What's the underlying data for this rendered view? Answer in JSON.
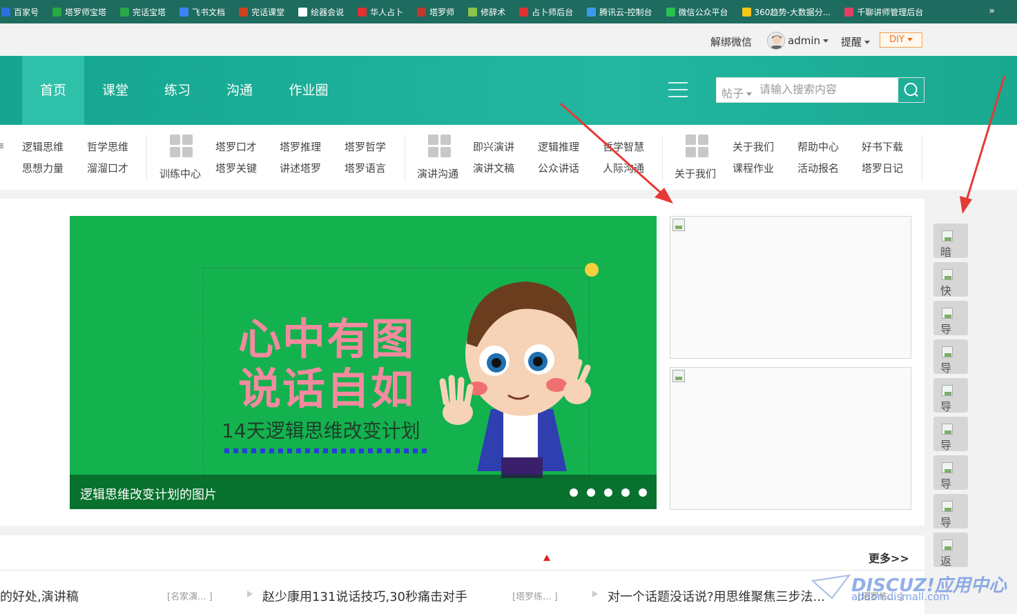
{
  "bookmarks": [
    {
      "label": "百家号",
      "color": "#2d6fe0",
      "icon": "baijiahao-icon"
    },
    {
      "label": "塔罗师宝塔",
      "color": "#27a844",
      "icon": "leaf-icon"
    },
    {
      "label": "完话宝塔",
      "color": "#27a844",
      "icon": "leaf-icon"
    },
    {
      "label": "飞书文档",
      "color": "#3b82f6",
      "icon": "doc-icon"
    },
    {
      "label": "完话课堂",
      "color": "#d04020",
      "icon": "sun-icon"
    },
    {
      "label": "绘器会说",
      "color": "#ffffff",
      "icon": "wordpress-icon"
    },
    {
      "label": "华人占卜",
      "color": "#e03030",
      "icon": "globe-icon"
    },
    {
      "label": "塔罗师",
      "color": "#c0392b",
      "icon": "pen-icon"
    },
    {
      "label": "修辞术",
      "color": "#8bc34a",
      "icon": "leaf-icon"
    },
    {
      "label": "占卜师后台",
      "color": "#e03030",
      "icon": "globe-icon"
    },
    {
      "label": "腾讯云-控制台",
      "color": "#3b9af0",
      "icon": "cloud-icon"
    },
    {
      "label": "微信公众平台",
      "color": "#27c24c",
      "icon": "wechat-icon"
    },
    {
      "label": "360趋势-大数据分...",
      "color": "#f5c518",
      "icon": "search-360-icon"
    },
    {
      "label": "千聊讲师管理后台",
      "color": "#e04060",
      "icon": "chat-icon"
    }
  ],
  "bookmarks_more": "»",
  "topbar": {
    "unbind_wechat": "解绑微信",
    "username": "admin",
    "remind": "提醒",
    "diy": "DIY"
  },
  "nav": {
    "items": [
      "首页",
      "课堂",
      "练习",
      "沟通",
      "作业圈"
    ],
    "active": 0
  },
  "search": {
    "type": "帖子",
    "placeholder": "请输入搜索内容"
  },
  "submenu": {
    "group1": {
      "row1": [
        "逻辑思维",
        "哲学思维"
      ],
      "row2": [
        "思想力量",
        "溜溜口才"
      ]
    },
    "group2": {
      "label": "训练中心",
      "row1": [
        "塔罗口才",
        "塔罗推理",
        "塔罗哲学"
      ],
      "row2": [
        "塔罗关键",
        "讲述塔罗",
        "塔罗语言"
      ]
    },
    "group3": {
      "label": "演讲沟通",
      "row1": [
        "即兴演讲",
        "逻辑推理",
        "哲学智慧"
      ],
      "row2": [
        "演讲文稿",
        "公众讲话",
        "人际沟通"
      ]
    },
    "group4": {
      "label": "关于我们",
      "row1": [
        "关于我们",
        "帮助中心",
        "好书下载"
      ],
      "row2": [
        "课程作业",
        "活动报名",
        "塔罗日记"
      ]
    }
  },
  "banner": {
    "line1": "心中有图",
    "line2": "说话自如",
    "line3": "14天逻辑思维改变计划",
    "caption": "逻辑思维改变计划的图片",
    "slide_count": 5
  },
  "right_bar": [
    "暗",
    "快",
    "导",
    "导",
    "导",
    "导",
    "导",
    "导",
    "返"
  ],
  "news": {
    "more": "更多>>",
    "items": [
      {
        "title": "的好处,演讲稿",
        "tag": "[名家演... ]"
      },
      {
        "title": "赵少康用131说话技巧,30秒痛击对手",
        "tag": "[塔罗练... ]"
      },
      {
        "title": "对一个话题没话说?用思维聚焦三步法...",
        "tag": "[塔罗练... ]"
      }
    ]
  },
  "watermark": {
    "line1": "DISCUZ!应用中心",
    "line2": "addon.dismall.com"
  },
  "colors": {
    "nav": "#1aa890",
    "banner": "#13b24e",
    "accent": "#f07020"
  }
}
